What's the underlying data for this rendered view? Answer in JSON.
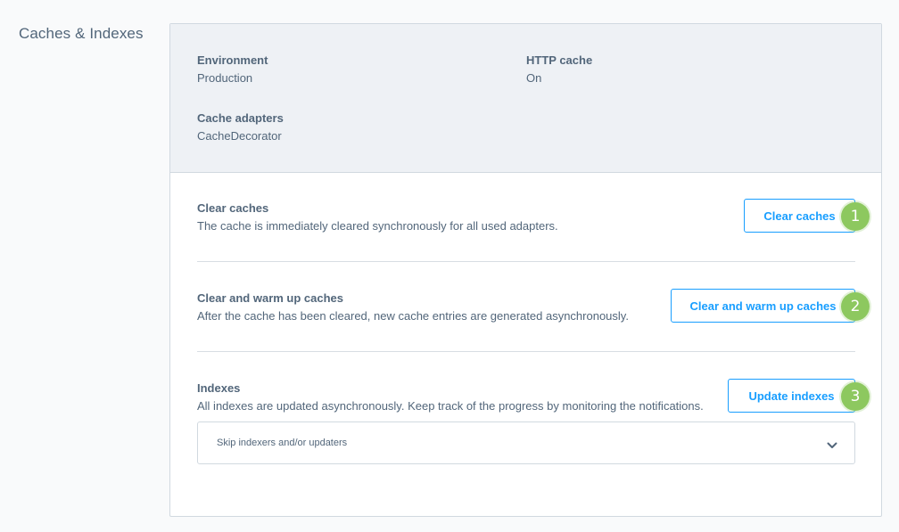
{
  "page": {
    "title": "Caches & Indexes"
  },
  "info": {
    "environment": {
      "label": "Environment",
      "value": "Production"
    },
    "http_cache": {
      "label": "HTTP cache",
      "value": "On"
    },
    "cache_adapters": {
      "label": "Cache adapters",
      "value": "CacheDecorator"
    }
  },
  "sections": [
    {
      "title": "Clear caches",
      "description": "The cache is immediately cleared synchronously for all used adapters.",
      "button_label": "Clear caches",
      "badge": "1"
    },
    {
      "title": "Clear and warm up caches",
      "description": "After the cache has been cleared, new cache entries are generated asynchronously.",
      "button_label": "Clear and warm up caches",
      "badge": "2"
    },
    {
      "title": "Indexes",
      "description": "All indexes are updated asynchronously. Keep track of the progress by monitoring the notifications.",
      "button_label": "Update indexes",
      "badge": "3"
    }
  ],
  "skip_select": {
    "placeholder": "Skip indexers and/or updaters",
    "icon": "chevron-down-icon"
  },
  "colors": {
    "accent": "#189eff",
    "badge": "#8dc85f",
    "info_panel_bg": "#eef1f5",
    "text": "#52667a"
  }
}
